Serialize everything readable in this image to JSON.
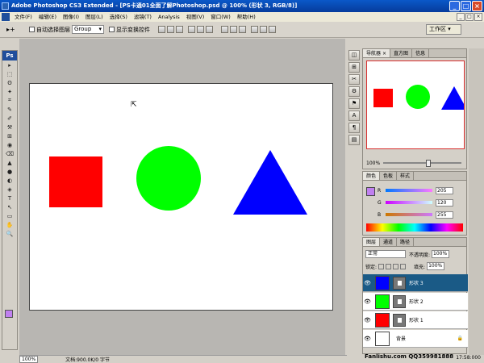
{
  "titlebar": {
    "title": "Adobe Photoshop CS3 Extended - [PS卡通01全面了解Photoshop.psd @ 100% (形状 3, RGB/8)]",
    "min": "_",
    "max": "□",
    "close": "×"
  },
  "menu": [
    "文件(F)",
    "编辑(E)",
    "图像(I)",
    "图层(L)",
    "选择(S)",
    "滤镜(T)",
    "Analysis",
    "视图(V)",
    "窗口(W)",
    "帮助(H)"
  ],
  "menu_right": [
    "_",
    "□",
    "×"
  ],
  "options": {
    "tool_glyph": "▸+",
    "auto_select_label": "自动选择图层",
    "auto_select_value": "Group",
    "show_transform_label": "显示变换控件",
    "workspace_label": "工作区 ▾"
  },
  "toolbox": {
    "logo": "Ps",
    "tools": [
      "▸",
      "⬚",
      "ʘ",
      "✦",
      "⌗",
      "✎",
      "✐",
      "⚒",
      "⊞",
      "◉",
      "⌫",
      "▲",
      "●",
      "◐",
      "◈",
      "T",
      "↖",
      "▭",
      "✋",
      "🔍"
    ]
  },
  "canvas": {
    "shapes": [
      {
        "kind": "square",
        "name": "形状 1",
        "color": "#ff0000"
      },
      {
        "kind": "circle",
        "name": "形状 2",
        "color": "#00ff00"
      },
      {
        "kind": "triangle",
        "name": "形状 3",
        "color": "#0000ff"
      }
    ]
  },
  "statusbar": {
    "zoom": "100%",
    "doc": "文档:900.0K/0 字节"
  },
  "dock_icons": [
    "◫",
    "⊞",
    "✂",
    "⚙",
    "⚑",
    "A",
    "¶",
    "▤"
  ],
  "navigator": {
    "tabs": [
      "导航器",
      "直方图",
      "信息"
    ],
    "tab_close": "×",
    "zoom": "100%"
  },
  "color": {
    "tabs": [
      "颜色",
      "色板",
      "样式"
    ],
    "fg": "#c080f0",
    "rows": [
      {
        "label": "R",
        "value": "205"
      },
      {
        "label": "G",
        "value": "120"
      },
      {
        "label": "B",
        "value": "255"
      }
    ]
  },
  "layers": {
    "tabs": [
      "图层",
      "通道",
      "路径"
    ],
    "blend": "正常",
    "opacity_label": "不透明度:",
    "opacity": "100%",
    "lock_label": "锁定:",
    "fill_label": "填充:",
    "fill": "100%",
    "items": [
      {
        "name": "形状 3",
        "color": "#0000ff",
        "selected": true,
        "mask": true
      },
      {
        "name": "形状 2",
        "color": "#00ff00",
        "selected": false,
        "mask": true
      },
      {
        "name": "形状 1",
        "color": "#ff0000",
        "selected": false,
        "mask": true
      },
      {
        "name": "背景",
        "color": "#ffffff",
        "selected": false,
        "mask": false
      }
    ],
    "eye": "👁",
    "lock_icon": "🔒"
  },
  "watermark": "Fanlishu.com QQ359981888",
  "clock": "17:58:000"
}
